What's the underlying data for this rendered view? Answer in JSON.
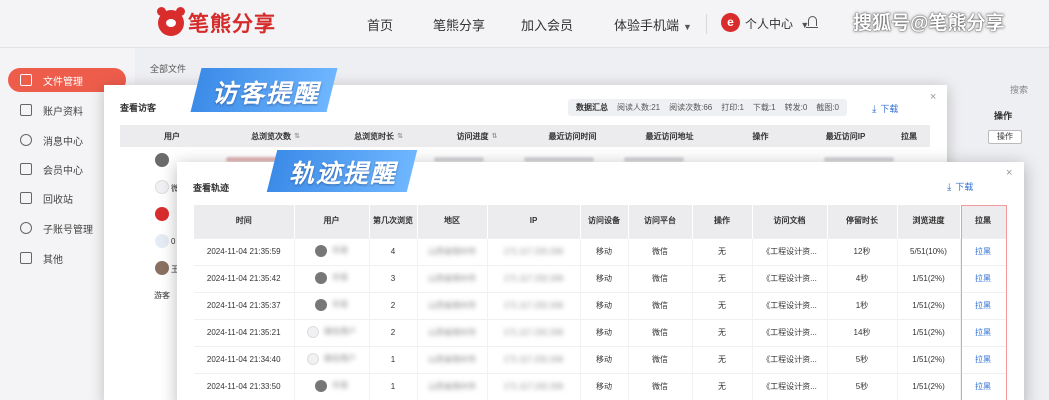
{
  "header": {
    "logo_text": "笔熊分享",
    "nav": [
      "首页",
      "笔熊分享",
      "加入会员",
      "体验手机端"
    ],
    "user_badge": "e",
    "user_center": "个人中心",
    "watermark": "搜狐号@笔熊分享"
  },
  "sidebar": {
    "items": [
      "文件管理",
      "账户资料",
      "消息中心",
      "会员中心",
      "回收站",
      "子账号管理",
      "其他"
    ]
  },
  "background_page": {
    "breadcrumb": "全部文件",
    "search_label": "搜索",
    "operation_header": "操作",
    "operation_button": "操作"
  },
  "visitor_modal": {
    "banner": "访客提醒",
    "title": "查看访客",
    "stats": {
      "label": "数据汇总",
      "readers": "阅读人数:21",
      "reads": "阅读次数:66",
      "prints": "打印:1",
      "downloads": "下载:1",
      "forwards": "转发:0",
      "screenshots": "截图:0"
    },
    "download": "下载",
    "columns": [
      "用户",
      "总浏览次数",
      "总浏览时长",
      "访问进度",
      "最近访问时间",
      "最近访问地址",
      "操作",
      "最近访问IP",
      "拉黑"
    ],
    "rows": [
      {
        "initial": "",
        "name": ""
      },
      {
        "initial": "",
        "name": "微"
      },
      {
        "initial": "",
        "name": ""
      },
      {
        "initial": "",
        "name": "0"
      },
      {
        "initial": "",
        "name": "王"
      }
    ],
    "guest_label": "游客"
  },
  "track_modal": {
    "banner": "轨迹提醒",
    "title": "查看轨迹",
    "download": "下载",
    "columns": [
      "时间",
      "用户",
      "第几次浏览",
      "地区",
      "IP",
      "访问设备",
      "访问平台",
      "操作",
      "访问文档",
      "停留时长",
      "浏览进度",
      "拉黑"
    ],
    "rows": [
      {
        "time": "2024-11-04 21:35:59",
        "user": "华哥",
        "visit_no": "4",
        "region": "山西省朔州市",
        "ip": "171.117.232.206",
        "device": "移动",
        "platform": "微信",
        "action": "无",
        "doc": "《工程设计资...",
        "stay": "12秒",
        "progress": "5/51(10%)",
        "block": "拉黑"
      },
      {
        "time": "2024-11-04 21:35:42",
        "user": "华哥",
        "visit_no": "3",
        "region": "山西省朔州市",
        "ip": "171.117.232.206",
        "device": "移动",
        "platform": "微信",
        "action": "无",
        "doc": "《工程设计资...",
        "stay": "4秒",
        "progress": "1/51(2%)",
        "block": "拉黑"
      },
      {
        "time": "2024-11-04 21:35:37",
        "user": "华哥",
        "visit_no": "2",
        "region": "山西省朔州市",
        "ip": "171.117.232.206",
        "device": "移动",
        "platform": "微信",
        "action": "无",
        "doc": "《工程设计资...",
        "stay": "1秒",
        "progress": "1/51(2%)",
        "block": "拉黑"
      },
      {
        "time": "2024-11-04 21:35:21",
        "user": "微信用户",
        "visit_no": "2",
        "region": "山西省朔州市",
        "ip": "171.117.232.206",
        "device": "移动",
        "platform": "微信",
        "action": "无",
        "doc": "《工程设计资...",
        "stay": "14秒",
        "progress": "1/51(2%)",
        "block": "拉黑"
      },
      {
        "time": "2024-11-04 21:34:40",
        "user": "微信用户",
        "visit_no": "1",
        "region": "山西省朔州市",
        "ip": "171.117.232.206",
        "device": "移动",
        "platform": "微信",
        "action": "无",
        "doc": "《工程设计资...",
        "stay": "5秒",
        "progress": "1/51(2%)",
        "block": "拉黑"
      },
      {
        "time": "2024-11-04 21:33:50",
        "user": "华哥",
        "visit_no": "1",
        "region": "山西省朔州市",
        "ip": "171.117.232.206",
        "device": "移动",
        "platform": "微信",
        "action": "无",
        "doc": "《工程设计资...",
        "stay": "5秒",
        "progress": "1/51(2%)",
        "block": "拉黑"
      }
    ]
  }
}
